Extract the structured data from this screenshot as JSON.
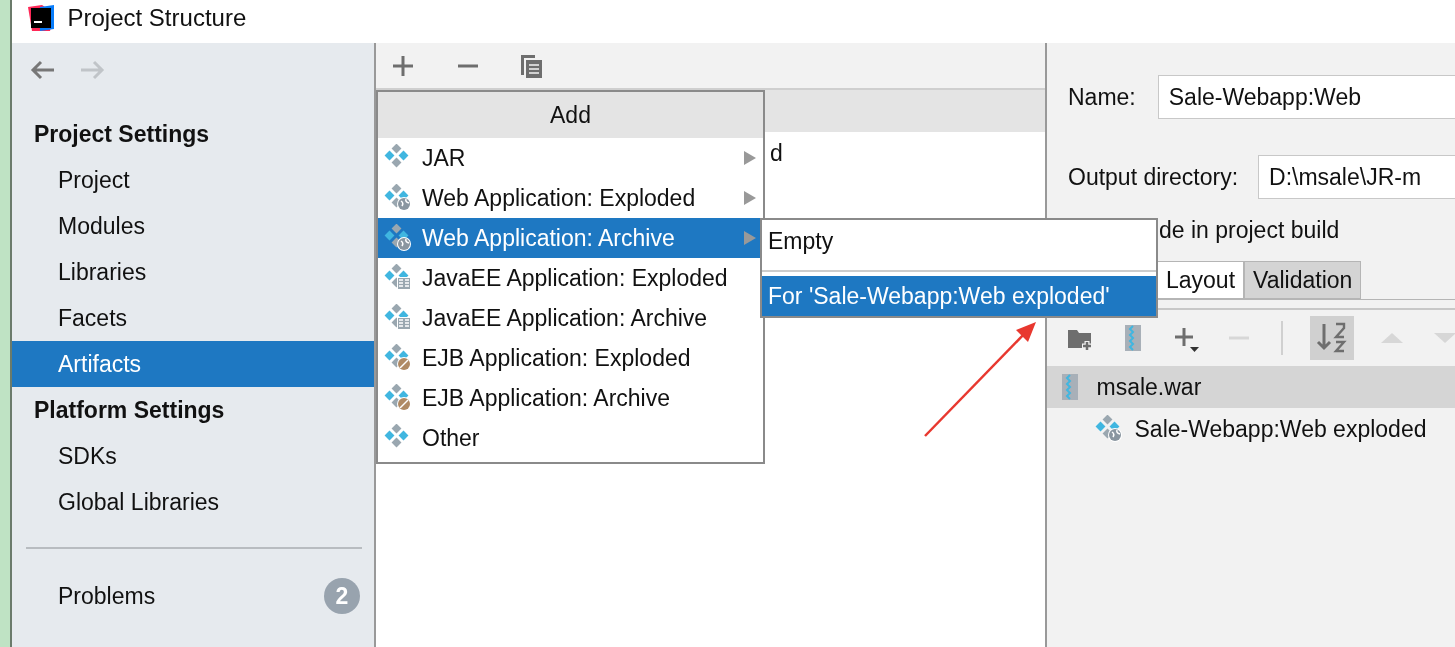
{
  "window": {
    "title": "Project Structure"
  },
  "sidebar": {
    "nav": [
      {
        "kind": "back",
        "disabled": false
      },
      {
        "kind": "forward",
        "disabled": true
      }
    ],
    "sections": [
      {
        "heading": "Project Settings",
        "items": [
          {
            "label": "Project",
            "selected": false
          },
          {
            "label": "Modules",
            "selected": false
          },
          {
            "label": "Libraries",
            "selected": false
          },
          {
            "label": "Facets",
            "selected": false
          },
          {
            "label": "Artifacts",
            "selected": true
          }
        ]
      },
      {
        "heading": "Platform Settings",
        "items": [
          {
            "label": "SDKs",
            "selected": false
          },
          {
            "label": "Global Libraries",
            "selected": false
          }
        ]
      }
    ],
    "problems": {
      "label": "Problems",
      "count": "2"
    }
  },
  "artifacts_panel": {
    "toolbar": [
      {
        "kind": "add",
        "disabled": false
      },
      {
        "kind": "remove",
        "disabled": false
      },
      {
        "kind": "copy",
        "disabled": false
      }
    ],
    "rows": [
      {
        "label": "d",
        "selected": false
      }
    ]
  },
  "add_menu": {
    "title": "Add",
    "items": [
      {
        "label": "JAR",
        "kind": "jar",
        "submenu": true,
        "selected": false
      },
      {
        "label": "Web Application: Exploded",
        "kind": "web",
        "submenu": true,
        "selected": false
      },
      {
        "label": "Web Application: Archive",
        "kind": "web",
        "submenu": true,
        "selected": true
      },
      {
        "label": "JavaEE Application: Exploded",
        "kind": "javaee",
        "submenu": false,
        "selected": false
      },
      {
        "label": "JavaEE Application: Archive",
        "kind": "javaee",
        "submenu": false,
        "selected": false
      },
      {
        "label": "EJB Application: Exploded",
        "kind": "ejb",
        "submenu": false,
        "selected": false
      },
      {
        "label": "EJB Application: Archive",
        "kind": "ejb",
        "submenu": false,
        "selected": false
      },
      {
        "label": "Other",
        "kind": "jar",
        "submenu": false,
        "selected": false
      }
    ]
  },
  "submenu": {
    "items": [
      {
        "label": "Empty",
        "selected": false
      },
      {
        "label": "For 'Sale-Webapp:Web exploded'",
        "selected": true
      }
    ]
  },
  "details": {
    "name_label": "Name:",
    "name_value": "Sale-Webapp:Web",
    "output_label": "Output directory:",
    "output_value": "D:\\msale\\JR-m",
    "build_label": "de in project build",
    "tabs": [
      {
        "label": "Layout",
        "selected": true
      },
      {
        "label": "Validation",
        "selected": false
      }
    ],
    "toolbar": [
      {
        "kind": "new-folder",
        "disabled": false
      },
      {
        "kind": "archive",
        "disabled": false
      },
      {
        "kind": "add-dropdown",
        "disabled": false
      },
      {
        "kind": "remove",
        "disabled": true
      },
      {
        "kind": "sort",
        "disabled": false
      },
      {
        "kind": "up",
        "disabled": true
      },
      {
        "kind": "down",
        "disabled": true
      }
    ],
    "tree": [
      {
        "label": "msale.war",
        "kind": "archive",
        "selected": true,
        "children": [
          {
            "label": "Sale-Webapp:Web exploded",
            "kind": "web",
            "selected": false
          }
        ]
      }
    ]
  }
}
